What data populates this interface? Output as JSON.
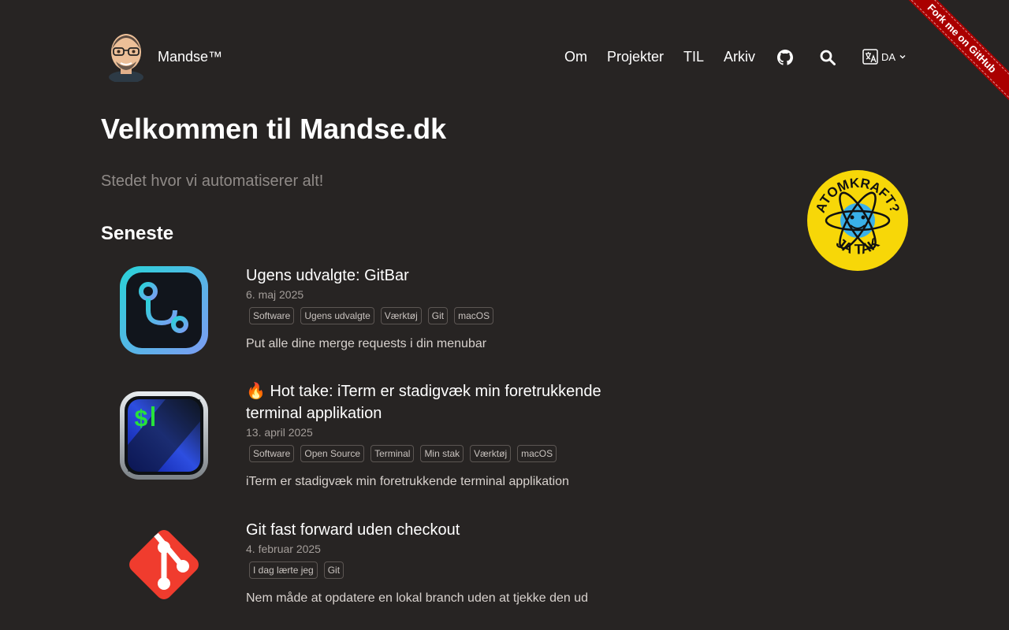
{
  "header": {
    "site_name": "Mandse™",
    "nav": [
      "Om",
      "Projekter",
      "TIL",
      "Arkiv"
    ],
    "lang": "DA"
  },
  "ribbon": {
    "label": "Fork me on GitHub"
  },
  "hero": {
    "title": "Velkommen til Mandse.dk",
    "tagline": "Stedet hvor vi automatiserer alt!"
  },
  "badge": {
    "top_text": "ATOMKRAFT?",
    "bottom_text": "JA TAK"
  },
  "latest": {
    "heading": "Seneste",
    "posts": [
      {
        "title": "Ugens udvalgte: GitBar",
        "date": "6. maj 2025",
        "tags": [
          "Software",
          "Ugens udvalgte",
          "Værktøj",
          "Git",
          "macOS"
        ],
        "summary": "Put alle dine merge requests i din menubar",
        "icon": "gitbar-icon"
      },
      {
        "title": "🔥 Hot take: iTerm er stadigvæk min foretrukkende terminal applikation",
        "date": "13. april 2025",
        "tags": [
          "Software",
          "Open Source",
          "Terminal",
          "Min stak",
          "Værktøj",
          "macOS"
        ],
        "summary": "iTerm er stadigvæk min foretrukkende terminal applikation",
        "icon": "iterm-icon"
      },
      {
        "title": "Git fast forward uden checkout",
        "date": "4. februar 2025",
        "tags": [
          "I dag lærte jeg",
          "Git"
        ],
        "summary": "Nem måde at opdatere en lokal branch uden at tjekke den ud",
        "icon": "git-icon"
      }
    ]
  },
  "colors": {
    "background": "#272423",
    "muted_text": "#8f8a87",
    "ribbon": "#aa0000",
    "git_red": "#f03c2e",
    "badge_yellow": "#f7d708"
  }
}
